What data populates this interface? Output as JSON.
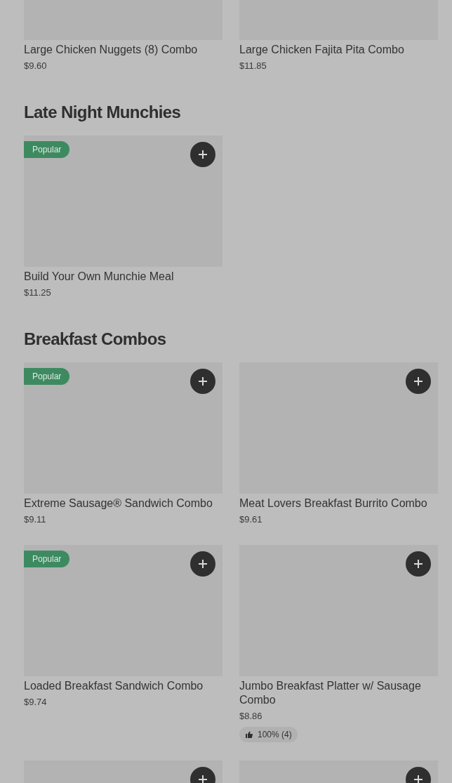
{
  "sections": [
    {
      "items": [
        {
          "name": "Large Chicken Nuggets (8) Combo",
          "price": "$9.60"
        },
        {
          "name": "Large Chicken Fajita Pita Combo",
          "price": "$11.85"
        }
      ]
    },
    {
      "title": "Late Night Munchies",
      "items": [
        {
          "name": "Build Your Own Munchie Meal",
          "price": "$11.25",
          "popular": true,
          "popular_label": "Popular"
        }
      ]
    },
    {
      "title": "Breakfast Combos",
      "items": [
        {
          "name": "Extreme Sausage® Sandwich Combo",
          "price": "$9.11",
          "popular": true,
          "popular_label": "Popular"
        },
        {
          "name": "Meat Lovers Breakfast Burrito Combo",
          "price": "$9.61",
          "popular": false
        },
        {
          "name": "Loaded Breakfast Sandwich Combo",
          "price": "$9.74",
          "popular": true,
          "popular_label": "Popular"
        },
        {
          "name": "Jumbo Breakfast Platter w/ Sausage Combo",
          "price": "$8.86",
          "popular": false,
          "rating": "100% (4)"
        },
        {
          "popular": false
        },
        {
          "popular": false
        }
      ]
    }
  ]
}
